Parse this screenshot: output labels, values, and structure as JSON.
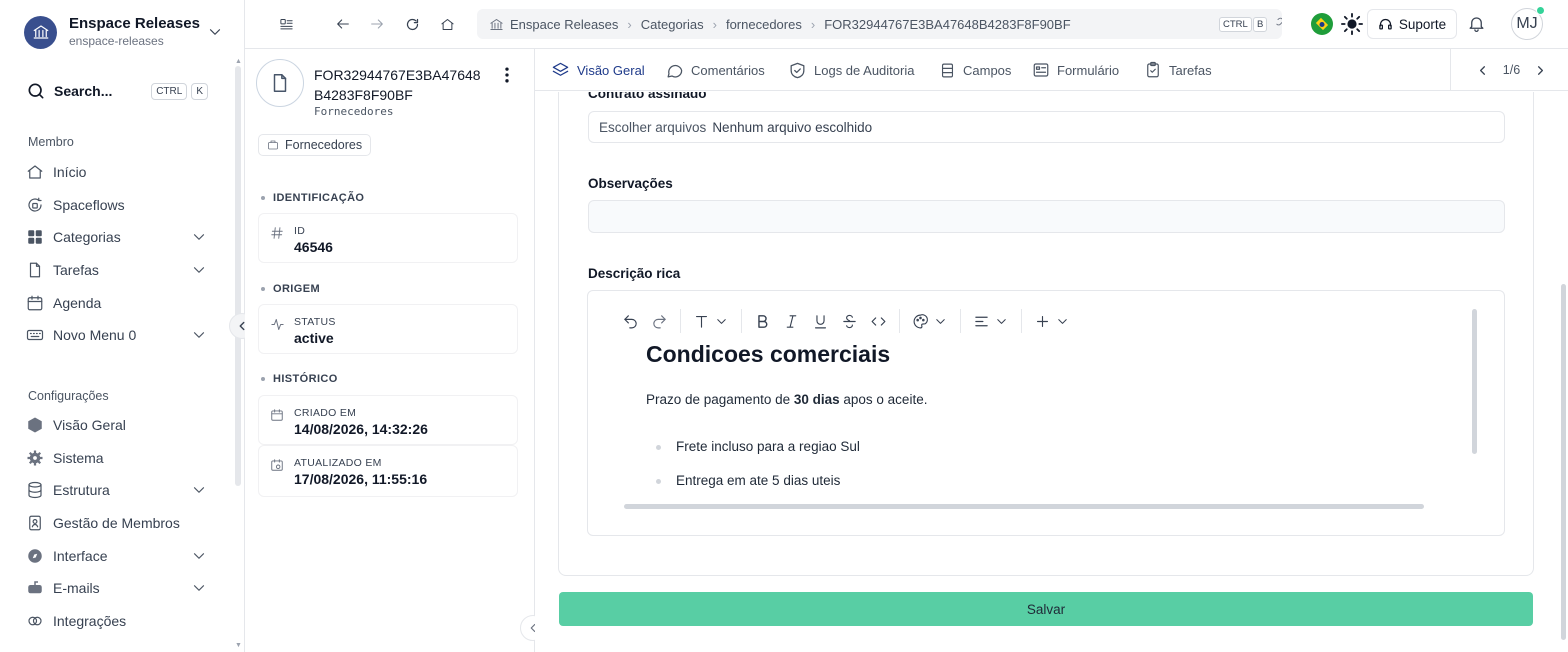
{
  "workspace": {
    "name": "Enspace Releases",
    "slug": "enspace-releases"
  },
  "search": {
    "label": "Search...",
    "kbd1": "CTRL",
    "kbd2": "K"
  },
  "sidebar": {
    "member_title": "Membro",
    "member_items": [
      {
        "label": "Início",
        "icon": "home-icon"
      },
      {
        "label": "Spaceflows",
        "icon": "spaceflows-icon"
      },
      {
        "label": "Categorias",
        "icon": "grid-icon"
      },
      {
        "label": "Tarefas",
        "icon": "file-icon"
      },
      {
        "label": "Agenda",
        "icon": "calendar-icon"
      },
      {
        "label": "Novo Menu 0",
        "icon": "keyboard-icon"
      }
    ],
    "config_title": "Configurações",
    "config_items": [
      {
        "label": "Visão Geral",
        "icon": "hexagon-icon"
      },
      {
        "label": "Sistema",
        "icon": "gear-icon"
      },
      {
        "label": "Estrutura",
        "icon": "database-icon"
      },
      {
        "label": "Gestão de Membros",
        "icon": "id-badge-icon"
      },
      {
        "label": "Interface",
        "icon": "compass-icon"
      },
      {
        "label": "E-mails",
        "icon": "mailbox-icon"
      },
      {
        "label": "Integrações",
        "icon": "integration-icon"
      }
    ]
  },
  "breadcrumb": {
    "items": [
      "Enspace Releases",
      "Categorias",
      "fornecedores",
      "FOR32944767E3BA47648B4283F8F90BF"
    ],
    "kbd1": "CTRL",
    "kbd2": "B"
  },
  "topbar": {
    "support_label": "Suporte",
    "avatar_initials": "MJ"
  },
  "record": {
    "title": "FOR32944767E3BA47648B4283F8F90BF",
    "subtitle": "Fornecedores",
    "tag": "Fornecedores",
    "groups": {
      "identificacao": "IDENTIFICAÇÃO",
      "origem": "ORIGEM",
      "historico": "HISTÓRICO"
    },
    "fields": {
      "id": {
        "label": "ID",
        "value": "46546"
      },
      "status": {
        "label": "STATUS",
        "value": "active"
      },
      "created": {
        "label": "CRIADO EM",
        "value": "14/08/2026, 14:32:26"
      },
      "updated": {
        "label": "ATUALIZADO EM",
        "value": "17/08/2026, 11:55:16"
      }
    }
  },
  "tabs": [
    "Visão Geral",
    "Comentários",
    "Logs de Auditoria",
    "Campos",
    "Formulário",
    "Tarefas"
  ],
  "pager": "1/6",
  "form": {
    "contract_label": "Contrato assinado",
    "file_button": "Escolher arquivos",
    "file_none": "Nenhum arquivo escolhido",
    "notes_label": "Observações",
    "notes_value": "",
    "rich_label": "Descrição rica",
    "rich": {
      "heading": "Condicoes comerciais",
      "para_before": "Prazo de pagamento de ",
      "para_bold": "30 dias",
      "para_after": " apos o aceite.",
      "bullets": [
        "Frete incluso para a regiao Sul",
        "Entrega em ate 5 dias uteis"
      ]
    },
    "save_label": "Salvar"
  },
  "colors": {
    "accent": "#58cea4",
    "workspace_logo": "#394f8e",
    "online": "#34d399"
  }
}
